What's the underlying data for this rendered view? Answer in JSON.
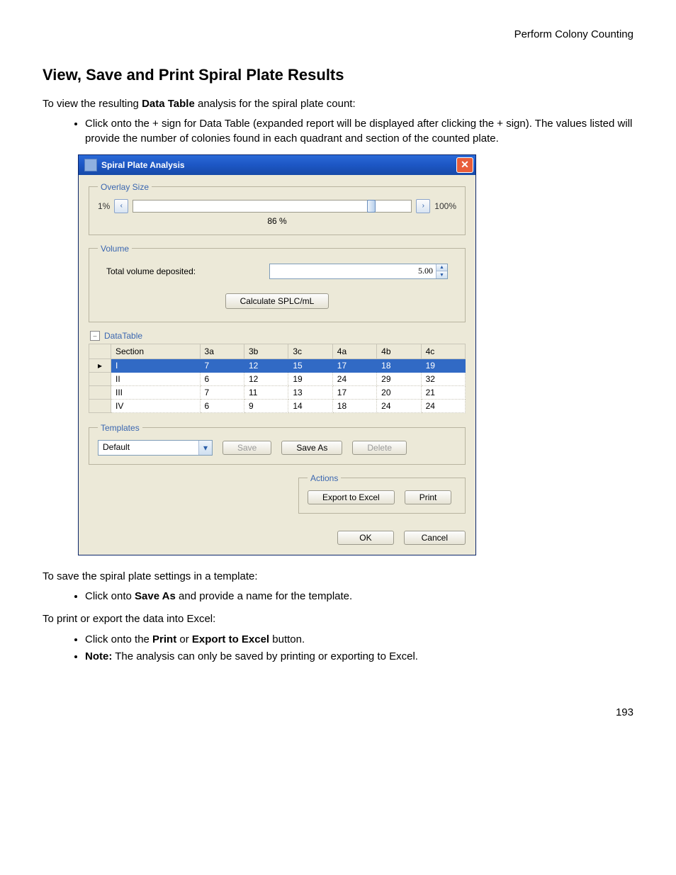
{
  "page": {
    "header": "Perform Colony Counting",
    "title": "View, Save and Print Spiral Plate Results",
    "intro_pre": "To view the resulting ",
    "intro_bold": "Data Table",
    "intro_post": " analysis for the spiral plate count:",
    "bullet1": "Click onto the + sign for Data Table (expanded report will be displayed after clicking the + sign). The values listed will provide the number of colonies found in each quadrant and section of the counted plate.",
    "save_intro": "To save the spiral plate settings in a template:",
    "save_bullet_pre": "Click onto ",
    "save_bullet_bold": "Save As",
    "save_bullet_post": " and provide a name for the template.",
    "print_intro": "To print or export the data into Excel:",
    "print_bullet_pre": "Click onto the ",
    "print_bullet_bold1": "Print",
    "print_bullet_mid": " or ",
    "print_bullet_bold2": "Export to Excel",
    "print_bullet_post": " button.",
    "note_bold": "Note:",
    "note_post": " The analysis can only be saved by printing or exporting to Excel.",
    "pagenum": "193"
  },
  "dialog": {
    "title": "Spiral Plate Analysis",
    "overlay": {
      "legend": "Overlay Size",
      "min": "1%",
      "max": "100%",
      "value": "86 %",
      "thumb_pct": 86
    },
    "volume": {
      "legend": "Volume",
      "label": "Total volume deposited:",
      "value": "5.00",
      "calc": "Calculate SPLC/mL"
    },
    "datatable": {
      "label": "DataTable",
      "headers": [
        "Section",
        "3a",
        "3b",
        "3c",
        "4a",
        "4b",
        "4c"
      ],
      "rows": [
        {
          "sel": true,
          "cells": [
            "I",
            "7",
            "12",
            "15",
            "17",
            "18",
            "19"
          ]
        },
        {
          "sel": false,
          "cells": [
            "II",
            "6",
            "12",
            "19",
            "24",
            "29",
            "32"
          ]
        },
        {
          "sel": false,
          "cells": [
            "III",
            "7",
            "11",
            "13",
            "17",
            "20",
            "21"
          ]
        },
        {
          "sel": false,
          "cells": [
            "IV",
            "6",
            "9",
            "14",
            "18",
            "24",
            "24"
          ]
        }
      ]
    },
    "templates": {
      "legend": "Templates",
      "selected": "Default",
      "save": "Save",
      "saveas": "Save As",
      "delete": "Delete"
    },
    "actions": {
      "legend": "Actions",
      "export": "Export to Excel",
      "print": "Print"
    },
    "ok": "OK",
    "cancel": "Cancel"
  }
}
